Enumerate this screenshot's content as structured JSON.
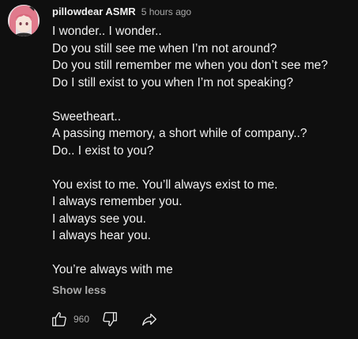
{
  "comment": {
    "author": "pillowdear ASMR",
    "timestamp": "5 hours ago",
    "lines": [
      "I wonder.. I wonder..",
      "Do you still see me when I’m not around?",
      "Do you still remember me when you don’t see me?",
      "Do I still exist to you when I’m not speaking?",
      "",
      "Sweetheart..",
      "A passing memory, a short while of company..?",
      "Do.. I exist to you?",
      "",
      "You exist to me. You’ll always exist to me.",
      "I always remember you.",
      "I always see you.",
      "I always hear you.",
      "",
      "You’re always with me"
    ],
    "show_less_label": "Show less",
    "like_count": "960"
  },
  "icons": {
    "like": "thumbs-up-icon",
    "dislike": "thumbs-down-icon",
    "share": "share-arrow-icon"
  },
  "colors": {
    "background": "#0f0f0f",
    "text": "#f1f1f1",
    "secondary_text": "#aaaaaa"
  }
}
